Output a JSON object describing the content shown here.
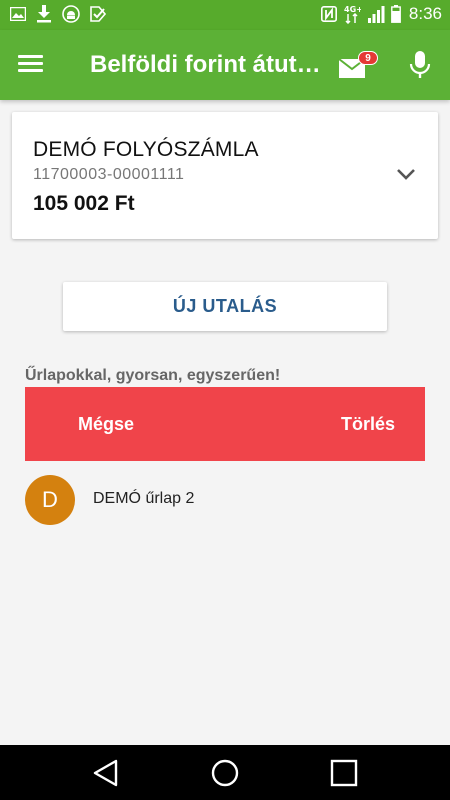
{
  "status_bar": {
    "time": "8:36",
    "network_label": "4G+",
    "left_icons": [
      "gallery-icon",
      "download-icon",
      "android-icon",
      "check-tag-icon"
    ],
    "right_icons": [
      "nfc-icon",
      "network-4g-icon",
      "signal-icon",
      "battery-icon"
    ]
  },
  "app_bar": {
    "title": "Belföldi forint átut…",
    "mail_badge_count": "9"
  },
  "account": {
    "name": "DEMÓ FOLYÓSZÁMLA",
    "number": "11700003-00001111",
    "balance": "105 002 Ft"
  },
  "actions": {
    "new_transfer_label": "ÚJ UTALÁS"
  },
  "forms_section": {
    "caption": "Űrlapokkal, gyorsan, egyszerűen!",
    "swipe": {
      "cancel_label": "Mégse",
      "delete_label": "Törlés"
    },
    "items": [
      {
        "initial": "D",
        "label": "DEMÓ űrlap 2"
      }
    ]
  },
  "colors": {
    "status_bar": "#57ab2c",
    "app_bar": "#5cb136",
    "delete_red": "#f0444a",
    "avatar": "#d4810f",
    "button_text": "#2a5c8c"
  }
}
